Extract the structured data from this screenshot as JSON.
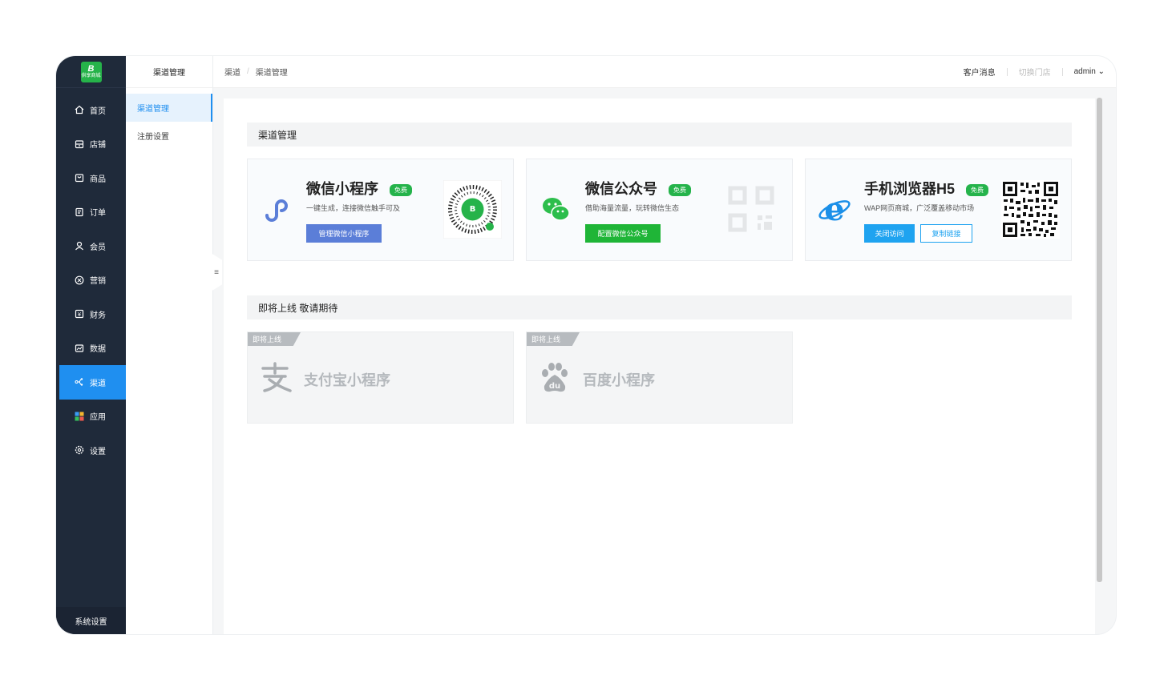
{
  "logo": {
    "text": "供享商城"
  },
  "nav": [
    {
      "label": "首页",
      "icon": "home-icon"
    },
    {
      "label": "店铺",
      "icon": "store-icon"
    },
    {
      "label": "商品",
      "icon": "product-icon"
    },
    {
      "label": "订单",
      "icon": "order-icon"
    },
    {
      "label": "会员",
      "icon": "user-icon"
    },
    {
      "label": "营销",
      "icon": "marketing-icon"
    },
    {
      "label": "财务",
      "icon": "finance-icon"
    },
    {
      "label": "数据",
      "icon": "data-icon"
    },
    {
      "label": "渠道",
      "icon": "channel-icon"
    },
    {
      "label": "应用",
      "icon": "apps-icon"
    },
    {
      "label": "设置",
      "icon": "gear-icon"
    }
  ],
  "nav_active": "渠道",
  "system_settings": "系统设置",
  "sub": {
    "title": "渠道管理",
    "items": [
      {
        "label": "渠道管理"
      },
      {
        "label": "注册设置"
      }
    ]
  },
  "breadcrumb": {
    "first": "渠道",
    "second": "渠道管理"
  },
  "header": {
    "messages": "客户消息",
    "switch_store": "切换门店",
    "user": "admin"
  },
  "section1": {
    "title": "渠道管理"
  },
  "cards": [
    {
      "name": "微信小程序",
      "tag": "免费",
      "desc": "一键生成，连接微信触手可及",
      "button": "管理微信小程序",
      "icon": "mini-program-icon"
    },
    {
      "name": "微信公众号",
      "tag": "免费",
      "desc": "借助海量流量，玩转微信生态",
      "button": "配置微信公众号",
      "icon": "wechat-icon"
    },
    {
      "name": "手机浏览器H5",
      "tag": "免费",
      "desc": "WAP网页商城，广泛覆盖移动市场",
      "button": "关闭访问",
      "button2": "复制链接",
      "icon": "ie-browser-icon"
    }
  ],
  "section2": {
    "title": "即将上线 敬请期待"
  },
  "soon": [
    {
      "ribbon": "即将上线",
      "name": "支付宝小程序",
      "icon": "alipay-icon"
    },
    {
      "ribbon": "即将上线",
      "name": "百度小程序",
      "icon": "baidu-icon"
    }
  ],
  "colors": {
    "sidebar": "#1f2a3a",
    "active": "#1f8ff0",
    "green": "#25b34b",
    "mini_btn": "#5b7ed8"
  }
}
